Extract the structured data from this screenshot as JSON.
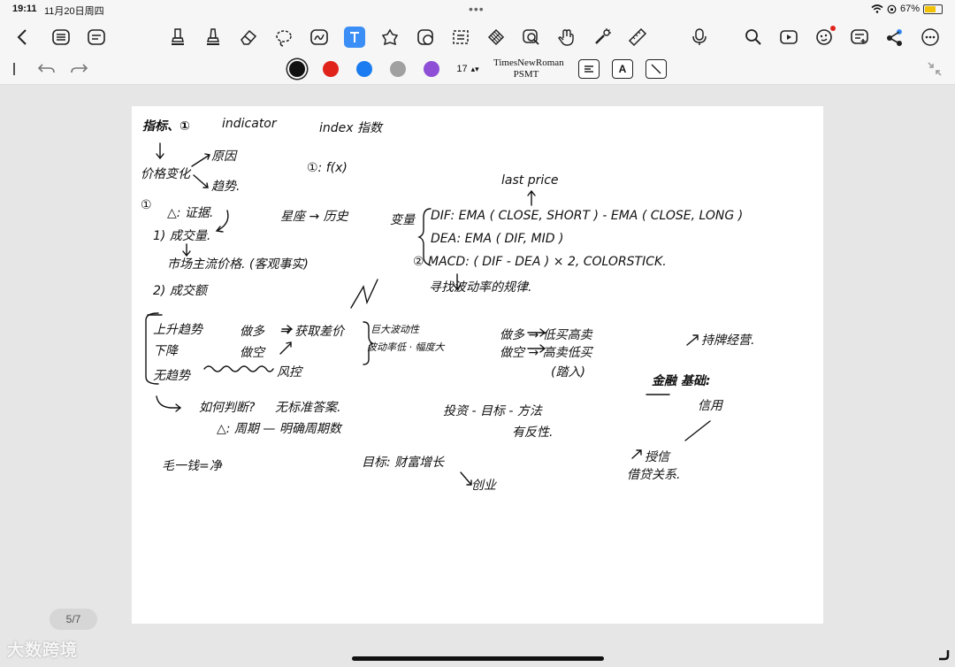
{
  "status": {
    "time": "19:11",
    "date": "11月20日周四",
    "battery": "67%",
    "battery_level": 0.67
  },
  "toolbar": {
    "icons": [
      "back-icon",
      "outline-icon",
      "page-list-icon",
      "pen-icon",
      "highlighter-icon",
      "eraser-icon",
      "lasso-icon",
      "shape-icon",
      "text-tool-icon",
      "sticker-icon",
      "element-icon",
      "select-icon",
      "grid-icon",
      "zoom-window-icon",
      "hand-icon",
      "laser-icon",
      "ruler-icon",
      "microphone-icon",
      "search-icon",
      "presentation-icon",
      "ai-icon",
      "comment-icon",
      "share-icon",
      "more-icon"
    ]
  },
  "toolbar2": {
    "colors": [
      "#111111",
      "#e0241c",
      "#1a7cf0",
      "#a0a0a0",
      "#8e4fd6"
    ],
    "size": "17",
    "font_name": "TimesNewRoman PSMT",
    "bold_label": "A"
  },
  "note": {
    "lines": [
      "指标、①",
      "indicator",
      "index 指数",
      "价格变化",
      "原因",
      "趋势.",
      "①: f(x)",
      "①",
      "△: 证据.",
      "1) 成交量.",
      "星座 → 历史",
      "last price",
      "变量",
      "DIF: EMA ( CLOSE, SHORT ) - EMA ( CLOSE, LONG )",
      "DEA: EMA ( DIF, MID )",
      "市场主流价格. (客观事实)",
      "② MACD: ( DIF - DEA ) × 2, COLORSTICK.",
      "2) 成交额",
      "寻找波动率的规律.",
      "上升趋势",
      "下降",
      "无趋势",
      "做多",
      "做空",
      "→ 获取差价",
      "巨大波动性",
      "波动率低 · 幅度大",
      "风控",
      "做多 → 低买高卖",
      "做空 → 高卖低买",
      "(踏入)",
      "持牌经营.",
      "金融 基础:",
      "信用",
      "如何判断?",
      "无标准答案.",
      "△: 周期 — 明确周期数",
      "投资 - 目标 - 方法",
      "有反性.",
      "毛一钱=净",
      "目标: 财富增长",
      "创业",
      "授信",
      "借贷关系."
    ]
  },
  "pager": {
    "label": "5/7"
  },
  "watermark": {
    "label": "大数跨境"
  }
}
